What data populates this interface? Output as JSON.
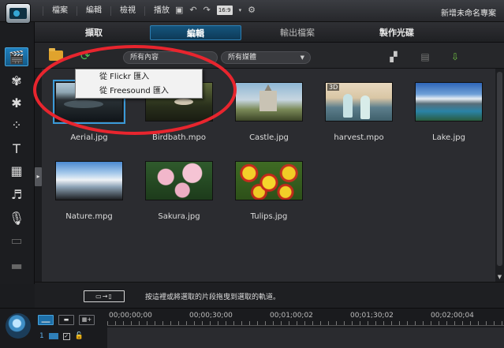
{
  "menu": {
    "items": [
      "檔案",
      "編輯",
      "檢視",
      "播放"
    ],
    "ratio_label": "16:9",
    "project_title": "新增未命名專案"
  },
  "modes": {
    "tabs": [
      "擷取",
      "編輯",
      "輸出檔案",
      "製作光碟"
    ],
    "active": "編輯"
  },
  "library": {
    "filter_content": "所有內容",
    "filter_media": "所有媒體",
    "import_menu": [
      "從 Flickr 匯入",
      "從 Freesound 匯入"
    ],
    "items": [
      {
        "label": "Aerial.jpg",
        "selected": true
      },
      {
        "label": "Birdbath.mpo",
        "badge": ""
      },
      {
        "label": "Castle.jpg"
      },
      {
        "label": "harvest.mpo",
        "badge": "3D"
      },
      {
        "label": "Lake.jpg"
      },
      {
        "label": "Nature.mpg"
      },
      {
        "label": "Sakura.jpg"
      },
      {
        "label": "Tulips.jpg"
      }
    ]
  },
  "hint": {
    "text": "按這裡或將選取的片段拖曳到選取的軌道。"
  },
  "timeline": {
    "ruler": [
      "00;00;00;00",
      "00;00;30;00",
      "00;01;00;02",
      "00;01;30;02",
      "00;02;00;04"
    ],
    "track_number": "1"
  },
  "colors": {
    "accent": "#1d6fa8",
    "annotation": "#e8252e"
  }
}
